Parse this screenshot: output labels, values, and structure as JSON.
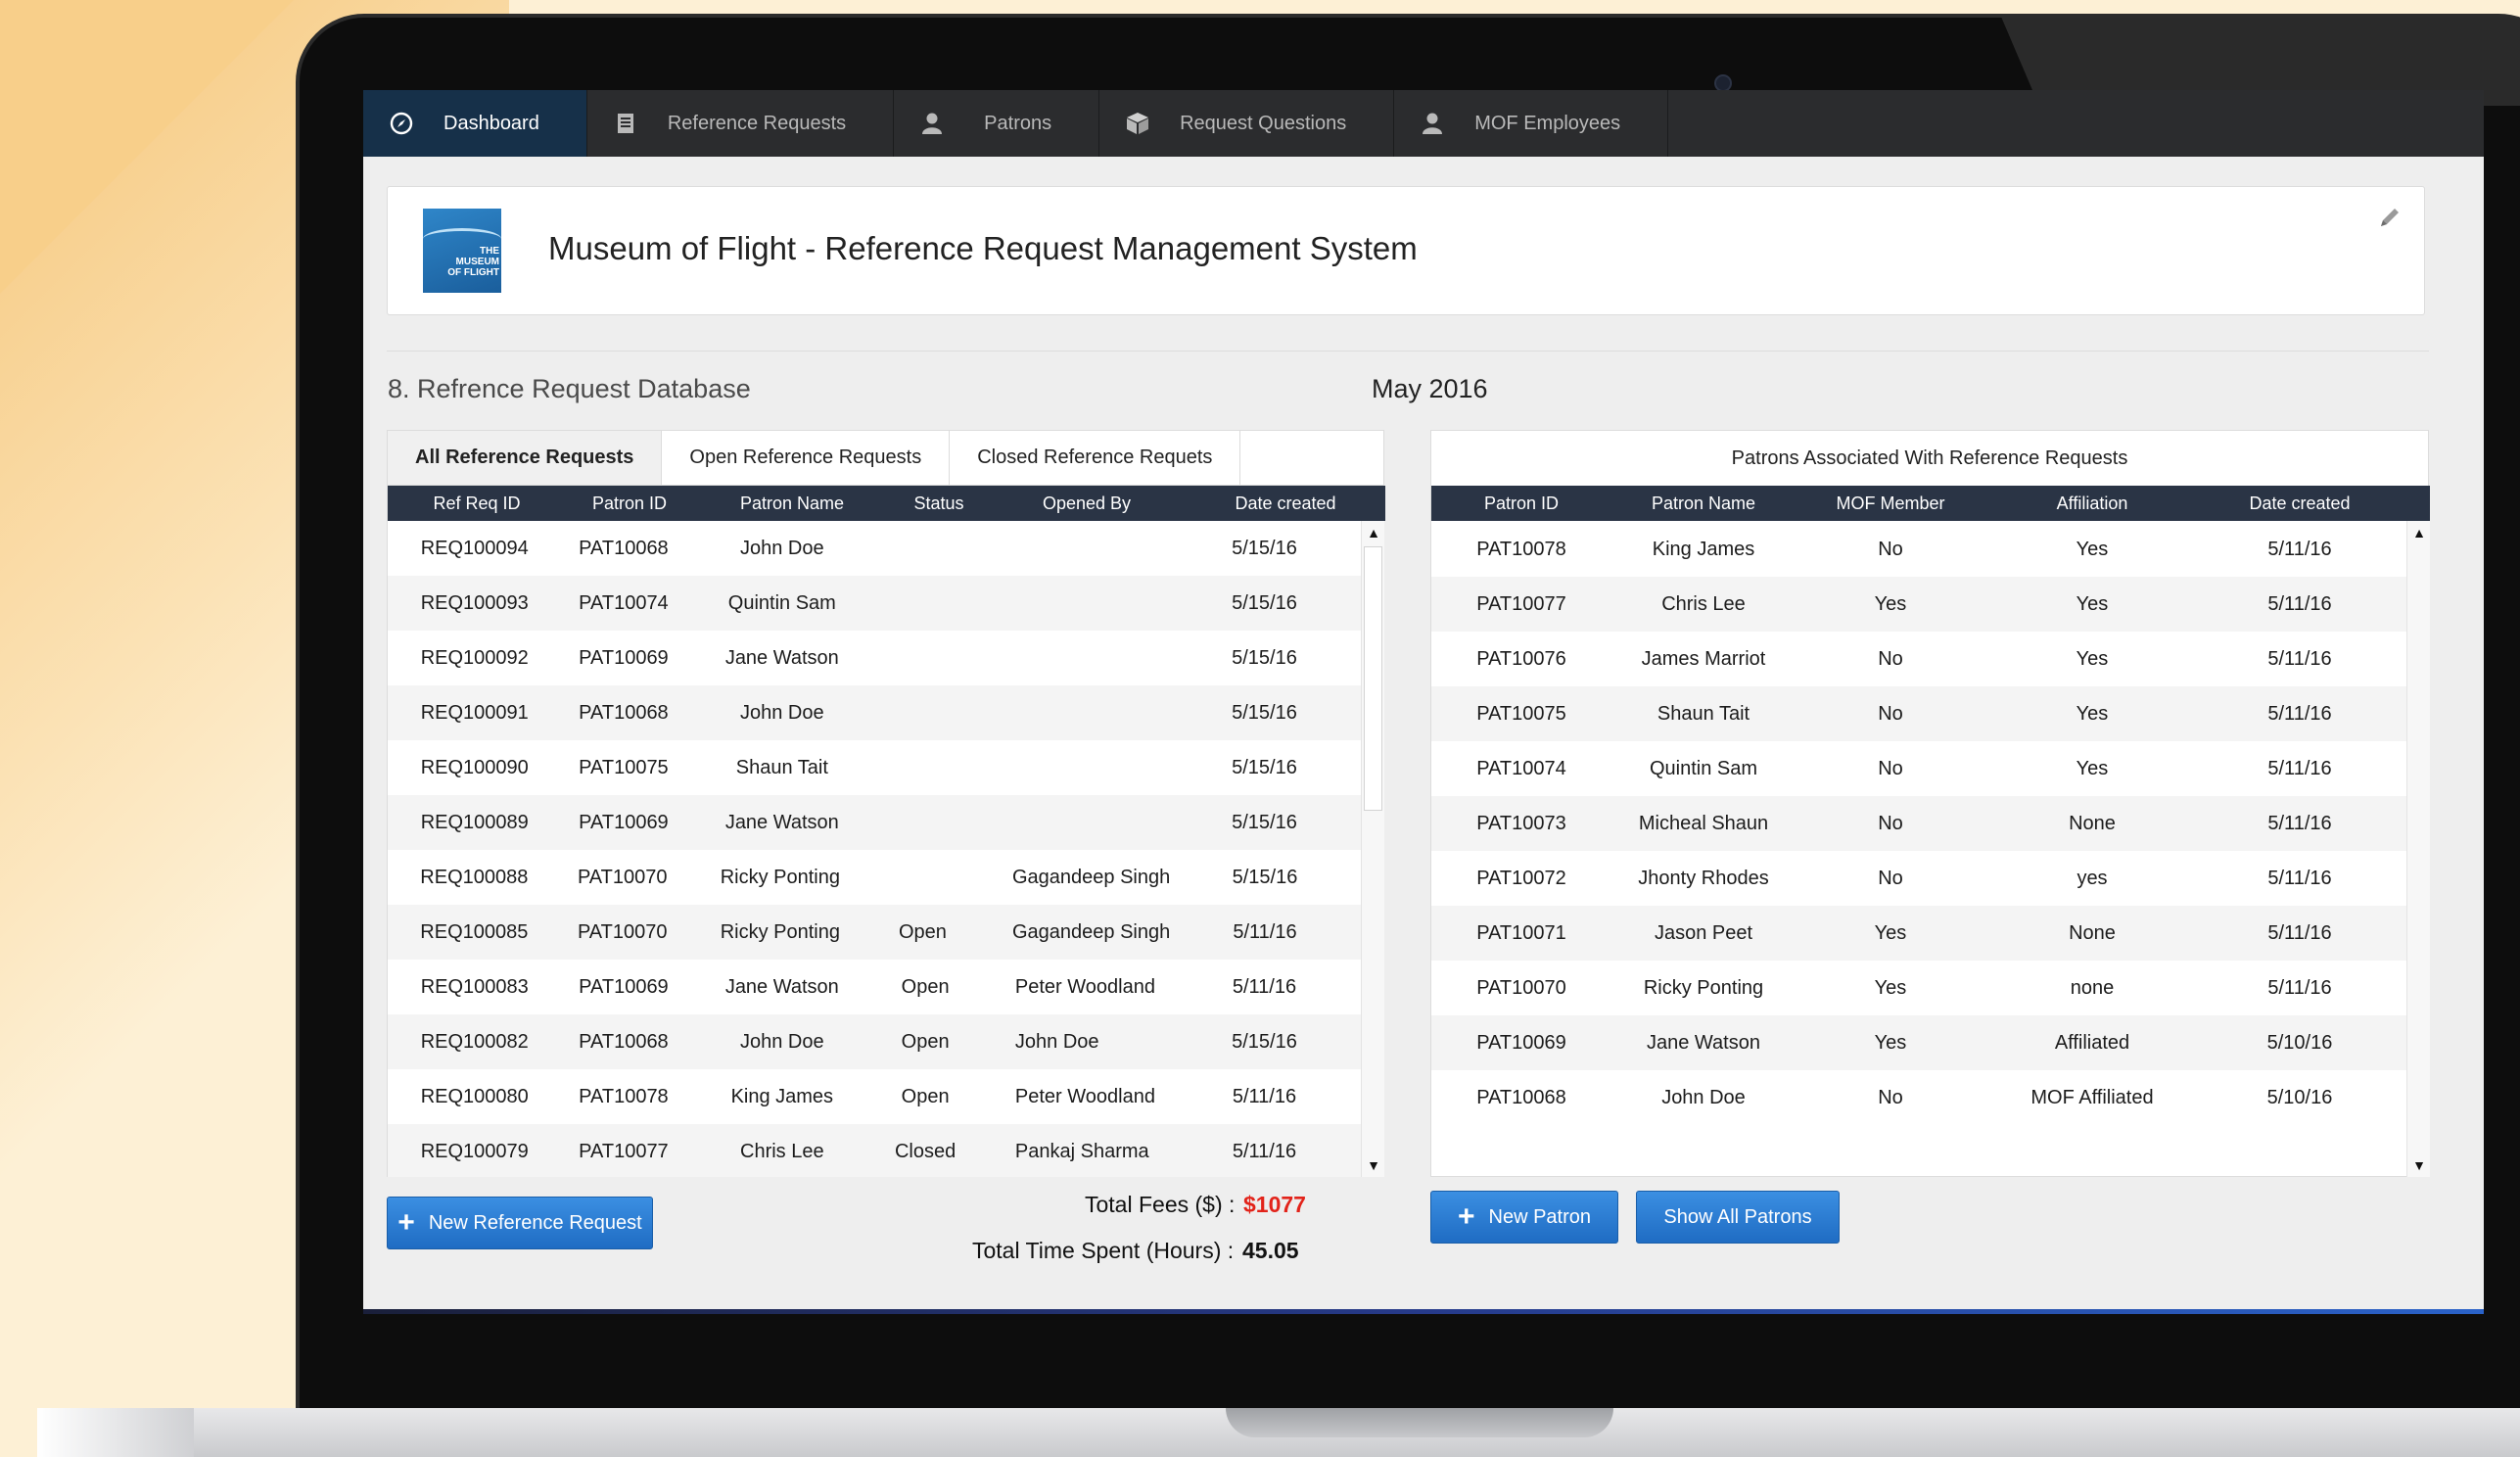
{
  "nav": {
    "items": [
      {
        "label": "Dashboard",
        "icon": "compass-icon",
        "active": true
      },
      {
        "label": "Reference Requests",
        "icon": "document-icon",
        "active": false
      },
      {
        "label": "Patrons",
        "icon": "user-icon",
        "active": false
      },
      {
        "label": "Request Questions",
        "icon": "box-icon",
        "active": false
      },
      {
        "label": "MOF Employees",
        "icon": "user-icon",
        "active": false
      }
    ]
  },
  "header": {
    "logo_text": [
      "THE",
      "MUSEUM",
      "OF FLIGHT"
    ],
    "title": "Museum of Flight - Reference Request Management System"
  },
  "section": {
    "title": "8. Refrence Request Database",
    "month": "May 2016"
  },
  "requests": {
    "tabs": [
      {
        "label": "All Reference Requests",
        "active": true
      },
      {
        "label": "Open Reference Requests",
        "active": false
      },
      {
        "label": "Closed Reference Requets",
        "active": false
      }
    ],
    "columns": [
      "Ref Req ID",
      "Patron ID",
      "Patron Name",
      "Status",
      "Opened By",
      "Date created"
    ],
    "rows": [
      [
        "REQ100094",
        "PAT10068",
        "John Doe",
        "",
        "",
        "5/15/16"
      ],
      [
        "REQ100093",
        "PAT10074",
        "Quintin Sam",
        "",
        "",
        "5/15/16"
      ],
      [
        "REQ100092",
        "PAT10069",
        "Jane Watson",
        "",
        "",
        "5/15/16"
      ],
      [
        "REQ100091",
        "PAT10068",
        "John Doe",
        "",
        "",
        "5/15/16"
      ],
      [
        "REQ100090",
        "PAT10075",
        "Shaun Tait",
        "",
        "",
        "5/15/16"
      ],
      [
        "REQ100089",
        "PAT10069",
        "Jane Watson",
        "",
        "",
        "5/15/16"
      ],
      [
        "REQ100088",
        "PAT10070",
        "Ricky Ponting",
        "",
        "Gagandeep Singh",
        "5/15/16"
      ],
      [
        "REQ100085",
        "PAT10070",
        "Ricky Ponting",
        "Open",
        "Gagandeep Singh",
        "5/11/16"
      ],
      [
        "REQ100083",
        "PAT10069",
        "Jane Watson",
        "Open",
        "Peter Woodland",
        "5/11/16"
      ],
      [
        "REQ100082",
        "PAT10068",
        "John Doe",
        "Open",
        "John Doe",
        "5/15/16"
      ],
      [
        "REQ100080",
        "PAT10078",
        "King James",
        "Open",
        "Peter Woodland",
        "5/11/16"
      ],
      [
        "REQ100079",
        "PAT10077",
        "Chris Lee",
        "Closed",
        "Pankaj Sharma",
        "5/11/16"
      ]
    ],
    "new_button_label": "New Reference Request"
  },
  "totals": {
    "fees_label": "Total Fees ($) :",
    "fees_value": "$1077",
    "time_label": "Total Time Spent (Hours) :",
    "time_value": "45.05"
  },
  "patrons": {
    "title": "Patrons Associated With Reference Requests",
    "columns": [
      "Patron ID",
      "Patron Name",
      "MOF Member",
      "Affiliation",
      "Date created"
    ],
    "rows": [
      [
        "PAT10078",
        "King James",
        "No",
        "Yes",
        "5/11/16"
      ],
      [
        "PAT10077",
        "Chris Lee",
        "Yes",
        "Yes",
        "5/11/16"
      ],
      [
        "PAT10076",
        "James Marriot",
        "No",
        "Yes",
        "5/11/16"
      ],
      [
        "PAT10075",
        "Shaun Tait",
        "No",
        "Yes",
        "5/11/16"
      ],
      [
        "PAT10074",
        "Quintin Sam",
        "No",
        "Yes",
        "5/11/16"
      ],
      [
        "PAT10073",
        "Micheal Shaun",
        "No",
        "None",
        "5/11/16"
      ],
      [
        "PAT10072",
        "Jhonty Rhodes",
        "No",
        "yes",
        "5/11/16"
      ],
      [
        "PAT10071",
        "Jason Peet",
        "Yes",
        "None",
        "5/11/16"
      ],
      [
        "PAT10070",
        "Ricky Ponting",
        "Yes",
        "none",
        "5/11/16"
      ],
      [
        "PAT10069",
        "Jane Watson",
        "Yes",
        "Affiliated",
        "5/10/16"
      ],
      [
        "PAT10068",
        "John Doe",
        "No",
        "MOF Affiliated",
        "5/10/16"
      ]
    ],
    "new_button_label": "New Patron",
    "show_all_label": "Show All Patrons"
  },
  "scroll": {
    "up": "▲",
    "down": "▼"
  },
  "colors": {
    "nav_bg": "#2b2c2e",
    "nav_active": "#163049",
    "table_header": "#2a3445",
    "button_blue": "#2a7ad3",
    "fees_red": "#e2231a"
  }
}
